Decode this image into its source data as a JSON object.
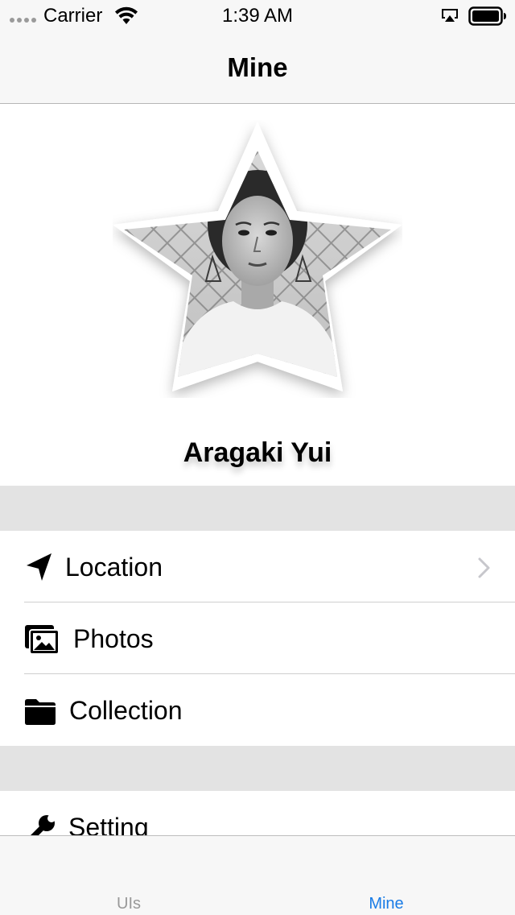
{
  "status_bar": {
    "carrier": "Carrier",
    "time": "1:39 AM",
    "icons": [
      "signal-dots-icon",
      "wifi-icon",
      "airplay-icon",
      "battery-icon"
    ]
  },
  "nav": {
    "title": "Mine"
  },
  "profile": {
    "name": "Aragaki Yui",
    "avatar": "star-shaped-photo"
  },
  "menu": {
    "section1": [
      {
        "label": "Location",
        "icon": "location-arrow-icon",
        "disclosure": true
      },
      {
        "label": "Photos",
        "icon": "photos-icon",
        "disclosure": false
      },
      {
        "label": "Collection",
        "icon": "folder-icon",
        "disclosure": false
      }
    ],
    "section2": [
      {
        "label": "Setting",
        "icon": "wrench-icon",
        "disclosure": false
      }
    ]
  },
  "tabs": [
    {
      "label": "UIs",
      "selected": false
    },
    {
      "label": "Mine",
      "selected": true
    }
  ],
  "colors": {
    "accent": "#1a7ce6",
    "inactive_tab": "#999999",
    "section_gap": "#e3e3e3",
    "bar_background": "#f7f7f7"
  }
}
